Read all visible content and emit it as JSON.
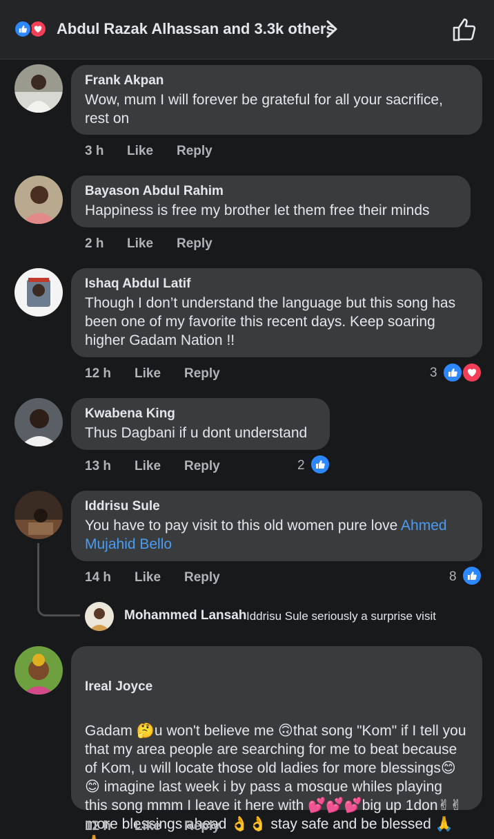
{
  "header": {
    "title": "Abdul Razak Alhassan and 3.3k others",
    "icons": [
      "like-reaction-icon",
      "love-reaction-icon",
      "chevron-right-icon",
      "thumbs-up-icon"
    ]
  },
  "actions": {
    "like": "Like",
    "reply": "Reply"
  },
  "comments": [
    {
      "name": "Frank Akpan",
      "text": "Wow, mum I will forever be grateful for all your sacrifice, rest on",
      "time": "3 h"
    },
    {
      "name": "Bayason Abdul Rahim",
      "text": "Happiness is free my brother let them free their minds",
      "time": "2 h"
    },
    {
      "name": "Ishaq Abdul Latif",
      "text": "Though I don’t understand the language but this song has been one of my favorite this recent days. Keep soaring higher Gadam Nation !!",
      "time": "12 h",
      "reaction_count": "3"
    },
    {
      "name": "Kwabena King",
      "text": "Thus Dagbani if u dont understand",
      "time": "13 h",
      "reaction_count": "2"
    },
    {
      "name": "Iddrisu Sule",
      "text": "You have to pay visit to this old women pure love ",
      "mention": "Ahmed Mujahid Bello",
      "time": "14 h",
      "reaction_count": "8",
      "reply": {
        "name": "Mohammed Lansah",
        "text": "Iddrisu Sule seriously a surprise visit"
      }
    },
    {
      "name": "Ireal  Joyce",
      "text": "Gadam 🤔u won't believe me 🙃that song \"Kom\" if I tell you that my area people are searching for me to beat because of Kom, u will locate those old ladies for more blessings😊😊 imagine last week i by pass a mosque whiles playing this song mmm I leave it here with 💕💕💕big up 1don✌✌ more blessings ahead 👌👌 stay safe and be blessed 🙏🙏",
      "time": "12 h"
    }
  ]
}
